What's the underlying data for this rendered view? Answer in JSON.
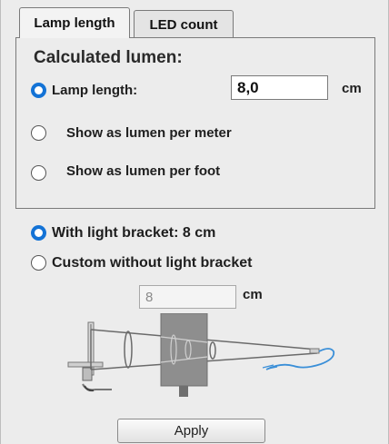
{
  "tabs": [
    {
      "label": "Lamp length",
      "active": true
    },
    {
      "label": "LED count",
      "active": false
    }
  ],
  "panel": {
    "title": "Calculated lumen:",
    "options": [
      {
        "label": "Lamp length:",
        "checked": true
      },
      {
        "label": "Show as lumen per meter",
        "checked": false
      },
      {
        "label": "Show as lumen per foot",
        "checked": false
      }
    ],
    "lamp_length_value": "8,0",
    "lamp_length_unit": "cm"
  },
  "bracket": {
    "options": [
      {
        "label": "With light bracket: 8 cm",
        "checked": true
      },
      {
        "label": "Custom without light bracket",
        "checked": false
      }
    ],
    "custom_value": "8",
    "custom_unit": "cm"
  },
  "apply_label": "Apply",
  "colors": {
    "accent": "#1473d6",
    "background": "#ececec",
    "cable": "#3a8fd8"
  }
}
